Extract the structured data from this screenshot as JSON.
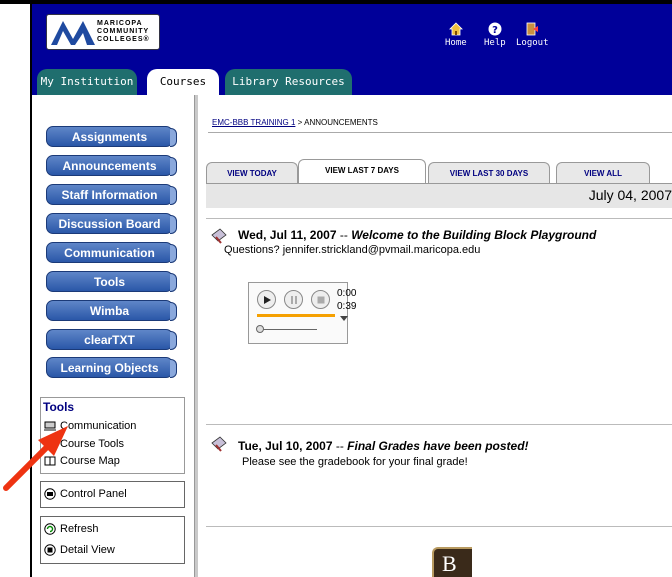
{
  "header": {
    "logo_lines": [
      "MARICOPA",
      "COMMUNITY",
      "COLLEGES®"
    ],
    "nav": [
      {
        "label": "Home",
        "icon": "home-icon"
      },
      {
        "label": "Help",
        "icon": "help-icon"
      },
      {
        "label": "Logout",
        "icon": "logout-icon"
      }
    ]
  },
  "tabs": [
    {
      "label": "My Institution"
    },
    {
      "label": "Courses",
      "active": true
    },
    {
      "label": "Library Resources"
    }
  ],
  "sidebar": {
    "buttons": [
      "Assignments",
      "Announcements",
      "Staff Information",
      "Discussion Board",
      "Communication",
      "Tools",
      "Wimba",
      "clearTXT",
      "Learning Objects"
    ],
    "tools_title": "Tools",
    "tools_items": [
      "Communication",
      "Course Tools",
      "Course Map"
    ],
    "control_panel": "Control Panel",
    "refresh": "Refresh",
    "detail_view": "Detail View"
  },
  "breadcrumb": {
    "course": "EMC-BBB TRAINING 1",
    "separator": " > ",
    "page": "ANNOUNCEMENTS"
  },
  "date_tabs": [
    "VIEW TODAY",
    "VIEW LAST 7 DAYS",
    "VIEW LAST 30 DAYS",
    "VIEW ALL"
  ],
  "current_date": "July 04, 2007",
  "announcements": [
    {
      "date": "Wed, Jul 11, 2007",
      "dash": " -- ",
      "title": "Welcome to the Building Block Playground",
      "body": "Questions? jennifer.strickland@pvmail.maricopa.edu"
    },
    {
      "date": "Tue, Jul 10, 2007",
      "dash": " -- ",
      "title": "Final Grades have been posted!",
      "body": "Please see the gradebook for your final grade!"
    }
  ],
  "player": {
    "elapsed": "0:00",
    "duration": "0:39"
  },
  "colors": {
    "header_bg": "#000099",
    "tab_green": "#1f6e6e",
    "nav_button": "#2a57a8",
    "player_progress": "#f5a000",
    "arrow": "#ee3311"
  }
}
